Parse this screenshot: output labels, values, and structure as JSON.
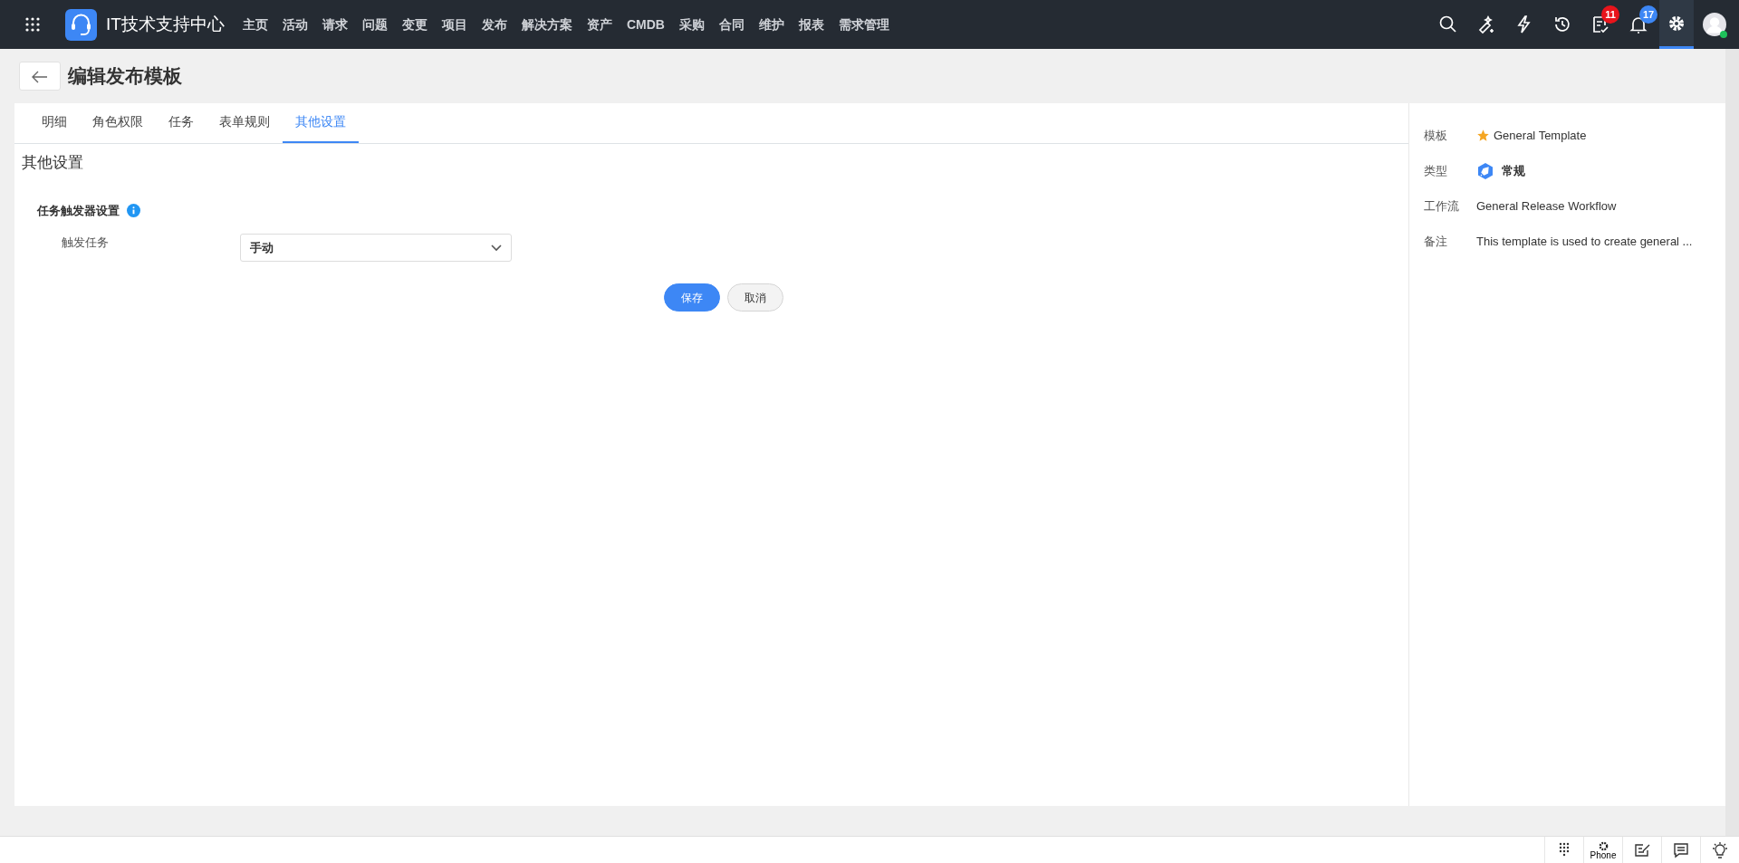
{
  "app": {
    "title": "IT技术支持中心"
  },
  "nav": [
    {
      "label": "主页"
    },
    {
      "label": "活动"
    },
    {
      "label": "请求"
    },
    {
      "label": "问题"
    },
    {
      "label": "变更"
    },
    {
      "label": "项目"
    },
    {
      "label": "发布"
    },
    {
      "label": "解决方案"
    },
    {
      "label": "资产"
    },
    {
      "label": "CMDB"
    },
    {
      "label": "采购"
    },
    {
      "label": "合同"
    },
    {
      "label": "维护"
    },
    {
      "label": "报表"
    },
    {
      "label": "需求管理"
    }
  ],
  "header_icons": [
    {
      "kind": "search"
    },
    {
      "kind": "wand"
    },
    {
      "kind": "bolt"
    },
    {
      "kind": "history"
    },
    {
      "kind": "tasks",
      "badge": "11"
    },
    {
      "kind": "bell",
      "badge": "17"
    },
    {
      "kind": "gear",
      "selected": true
    },
    {
      "kind": "avatar",
      "online": true
    }
  ],
  "page": {
    "title": "编辑发布模板"
  },
  "tabs": [
    {
      "label": "明细",
      "selected": false
    },
    {
      "label": "角色权限",
      "selected": false
    },
    {
      "label": "任务",
      "selected": false
    },
    {
      "label": "表单规则",
      "selected": false
    },
    {
      "label": "其他设置",
      "selected": true
    }
  ],
  "section": {
    "title": "其他设置",
    "group": "任务触发器设置",
    "field": {
      "label": "触发任务",
      "value": "手动"
    }
  },
  "buttons": [
    {
      "label": "保存",
      "kind": "primary"
    },
    {
      "label": "取消",
      "kind": "secondary"
    }
  ],
  "details": [
    {
      "label": "模板",
      "value": "General Template",
      "kind": "star"
    },
    {
      "label": "类型",
      "value": "常规",
      "kind": "type"
    },
    {
      "label": "工作流",
      "value": "General Release Workflow",
      "kind": "plain"
    },
    {
      "label": "备注",
      "value": "This template is used to create general ...",
      "kind": "plain"
    }
  ],
  "footer": [
    {
      "kind": "dialpad"
    },
    {
      "kind": "phone",
      "label": "Phone"
    },
    {
      "kind": "note"
    },
    {
      "kind": "chat"
    },
    {
      "kind": "bulb"
    }
  ]
}
